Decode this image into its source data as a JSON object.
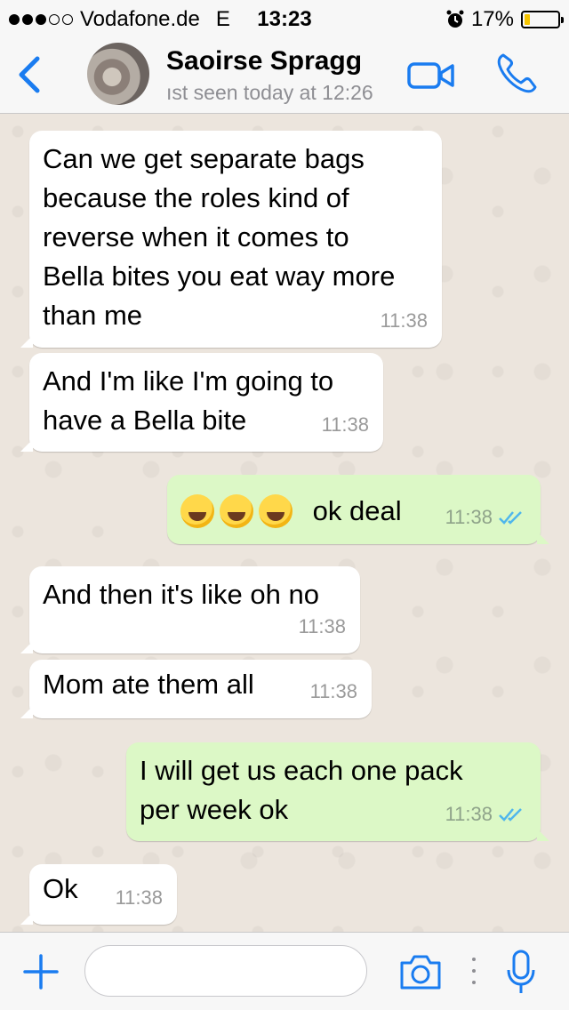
{
  "status_bar": {
    "carrier": "Vodafone.de",
    "network": "E",
    "time": "13:23",
    "battery_percent": "17%",
    "battery_level": 0.17,
    "battery_color": "#f5c400",
    "signal_bars": 3,
    "signal_max": 5,
    "alarm_icon": "alarm-clock-icon"
  },
  "header": {
    "contact_name": "Saoirse Spragg",
    "last_seen": "ıst seen today at 12:26",
    "accent_color": "#1a7cf0",
    "icons": [
      "back-chevron-icon",
      "video-camera-icon",
      "phone-icon"
    ]
  },
  "messages": [
    {
      "direction": "in",
      "lines": [
        "Can we get separate bags",
        "because the roles kind of",
        "reverse when it comes to",
        "Bella bites you eat way more",
        "than me"
      ],
      "time": "11:38"
    },
    {
      "direction": "in",
      "lines": [
        "And I'm like I'm going to",
        "have a Bella bite"
      ],
      "time": "11:38"
    },
    {
      "direction": "out",
      "emoji_count": 3,
      "emoji_name": "rolling-on-floor-laughing-emoji",
      "lines": [
        "ok deal"
      ],
      "time": "11:38",
      "read": true
    },
    {
      "direction": "in",
      "lines": [
        "And then it's like oh no"
      ],
      "time": "11:38"
    },
    {
      "direction": "in",
      "lines": [
        "Mom ate them all"
      ],
      "time": "11:38"
    },
    {
      "direction": "out",
      "lines": [
        "I will get us each one pack",
        "per week ok"
      ],
      "time": "11:38",
      "read": true
    },
    {
      "direction": "in",
      "lines": [
        "Ok"
      ],
      "time": "11:38"
    }
  ],
  "input_bar": {
    "placeholder": "",
    "icons": [
      "plus-icon",
      "camera-icon",
      "microphone-icon"
    ]
  },
  "colors": {
    "incoming_bubble": "#ffffff",
    "outgoing_bubble": "#dcf8c6",
    "chat_background": "#ece5dd",
    "read_ticks": "#4fb6ec"
  }
}
